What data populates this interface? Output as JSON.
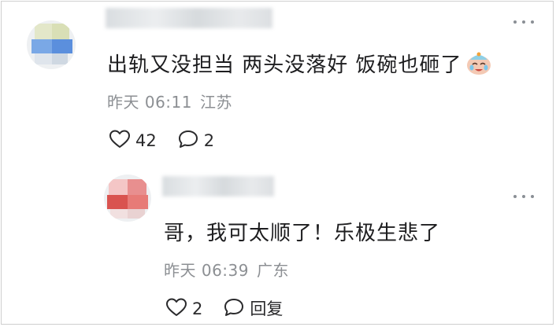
{
  "comments": [
    {
      "text": "出轨又没担当 两头没落好 饭碗也砸了",
      "emoji": "crying-face-emoji",
      "time": "昨天 06:11",
      "location": "江苏",
      "like_count": "42",
      "reply_count": "2",
      "like_icon": "heart-outline-icon",
      "reply_icon": "speech-bubble-icon"
    },
    {
      "text": "哥，我可太顺了！乐极生悲了",
      "time": "昨天 06:39",
      "location": "广东",
      "like_count": "2",
      "reply_label": "回复",
      "like_icon": "heart-outline-icon",
      "reply_icon": "speech-bubble-icon"
    }
  ],
  "colors": {
    "text_primary": "#1d1d1f",
    "text_secondary": "#8c8f93",
    "icon_stroke": "#2a2a2c",
    "border": "#cfcfcf"
  }
}
